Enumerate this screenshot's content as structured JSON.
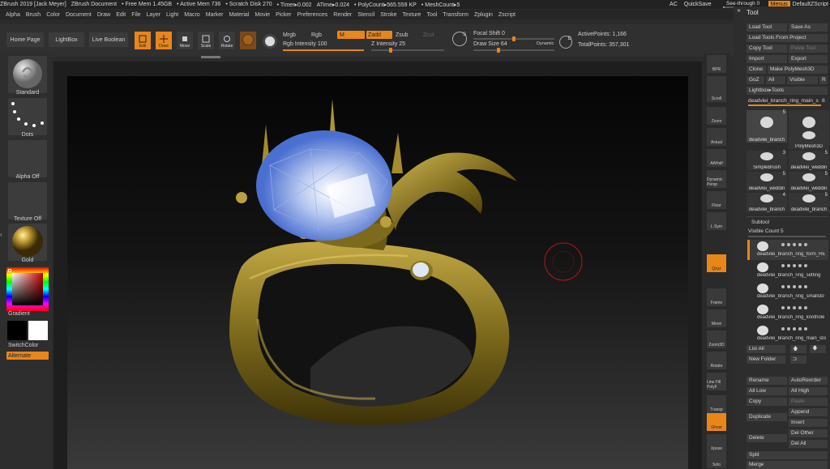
{
  "titlebar": {
    "items": [
      "ZBrush 2019 [Jack Meyer]",
      "ZBrush Document",
      "• Free Mem 1.45GB",
      "• Active Mem 736",
      "• Scratch Disk 270",
      "• Timer▸0.002",
      "ATime▸0.024",
      "• PolyCount▸565.559 KP",
      "• MeshCount▸5"
    ],
    "ac": "AC",
    "quicksave": "QuickSave",
    "see_through_label": "See-through",
    "see_through_value": "0",
    "menus": "Menus",
    "default_zscript": "DefaultZScript"
  },
  "menubar": [
    "Alpha",
    "Brush",
    "Color",
    "Document",
    "Draw",
    "Edit",
    "File",
    "Layer",
    "Light",
    "Macro",
    "Marker",
    "Material",
    "Movie",
    "Picker",
    "Preferences",
    "Render",
    "Stencil",
    "Stroke",
    "Texture",
    "Tool",
    "Transform",
    "Zplugin",
    "Zscript"
  ],
  "shelf": {
    "home_page": "Home Page",
    "lightbox": "LightBox",
    "live_boolean": "Live Boolean",
    "edit": "Edit",
    "draw": "Draw",
    "move": "Move",
    "scale": "Scale",
    "rotate": "Rotate",
    "mrgb": "Mrgb",
    "rgb": "Rgb",
    "m": "M",
    "zadd": "Zadd",
    "zsub": "Zsub",
    "zcut": "Zcut",
    "rgb_intensity_label": "Rgb Intensity",
    "rgb_intensity_value": "100",
    "z_intensity_label": "Z Intensity",
    "z_intensity_value": "25",
    "focal_shift_label": "Focal Shift",
    "focal_shift_value": "0",
    "draw_size_label": "Draw Size",
    "draw_size_value": "64",
    "dynamic": "Dynamic",
    "active_points_label": "ActivePoints:",
    "active_points_value": "1,166",
    "total_points_label": "TotalPoints:",
    "total_points_value": "357,301",
    "rgb_intensity_fraction": 1.0,
    "z_intensity_fraction": 0.25,
    "focal_shift_fraction": 0.5,
    "draw_size_fraction": 0.3
  },
  "left": {
    "standard": "Standard",
    "dots": "Dots",
    "alpha_off": "Alpha Off",
    "texture_off": "Texture Off",
    "gold": "Gold",
    "gradient": "Gradient",
    "switch_color": "SwitchColor",
    "alternate": "Alternate"
  },
  "rightstrip": [
    "BPR",
    "SPix 3",
    "Scroll",
    "Zoom",
    "Actual",
    "AAHalf",
    "Dynamic Persp",
    "Floor",
    "L.Sym",
    "",
    "Qxyz",
    "",
    "Frame",
    "Move",
    "Zoom3D",
    "Rotate",
    "Line Fill PolyF",
    "Transp",
    "Ghost",
    "Xpose",
    "Solo"
  ],
  "tool": {
    "title": "Tool",
    "load_tool": "Load Tool",
    "save_as": "Save As",
    "load_tools_from_project": "Load Tools From Project",
    "copy_tool": "Copy Tool",
    "paste_tool": "Paste Tool",
    "import": "Import",
    "export": "Export",
    "clone": "Clone",
    "make_polymesh3d": "Make PolyMesh3D",
    "goz": "GoZ",
    "all": "All",
    "visible": "Visible",
    "r": "R",
    "lightbox_tools": "Lightbox▸Tools",
    "current_tool": "deadvlei_branch_ring_main_s",
    "current_tool_count": "8",
    "thumbs": [
      {
        "name": "deadvlei_branch",
        "count": "5"
      },
      {
        "name": "Cylinder3D",
        "count": ""
      },
      {
        "name": "PolyMesh3D",
        "count": ""
      },
      {
        "name": "SimpleBrush",
        "count": "3"
      },
      {
        "name": "deadvlei_weddin",
        "count": "5"
      },
      {
        "name": "deadvlei_weddin",
        "count": "5"
      },
      {
        "name": "deadvlei_weddin",
        "count": "5"
      },
      {
        "name": "deadvlei_branch",
        "count": "4"
      },
      {
        "name": "deadvlei_branch",
        "count": "5"
      }
    ],
    "subtool_title": "Subtool",
    "visible_count": "Visible Count 5",
    "subtools": [
      "deadvlei_branch_ring_form_RE",
      "deadvlei_branch_ring_setting",
      "deadvlei_branch_ring_smallsto",
      "deadvlei_branch_ring_knothole",
      "deadvlei_branch_ring_main_sto"
    ],
    "list_all": "List All",
    "new_folder": "New Folder",
    "rename": "Rename",
    "auto_reorder": "AutoReorder",
    "all_low": "All Low",
    "all_high": "All High",
    "copy": "Copy",
    "paste": "Paste",
    "append": "Append",
    "duplicate": "Duplicate",
    "insert": "Insert",
    "delete": "Delete",
    "del_other": "Del Other",
    "del_all": "Del All",
    "split": "Split",
    "merge": "Merge"
  },
  "colors": {
    "accent": "#e8861a",
    "gold": "#8a7420",
    "gem": "#6f8ed8"
  }
}
